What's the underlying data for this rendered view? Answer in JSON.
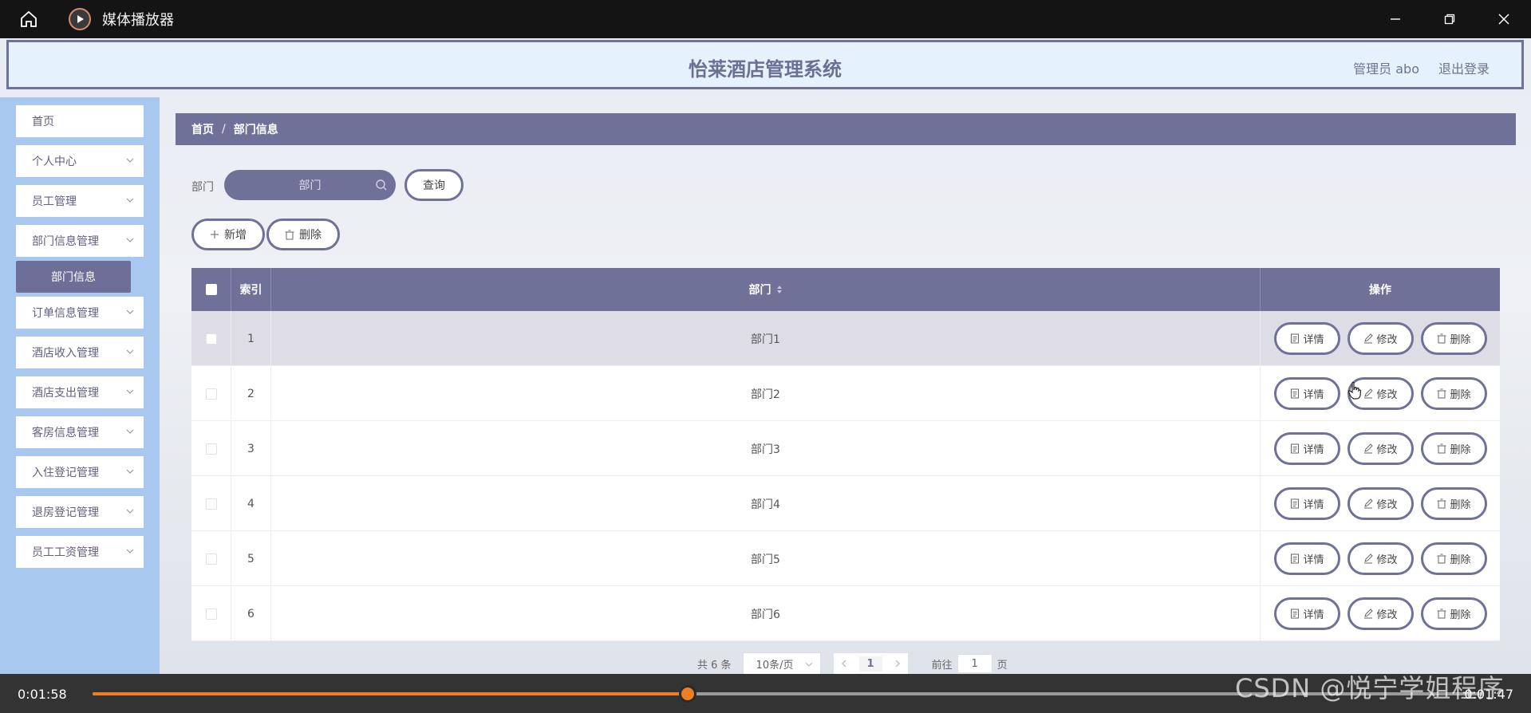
{
  "window": {
    "title": "媒体播放器"
  },
  "app": {
    "title": "怡莱酒店管理系统",
    "user": "管理员 abo",
    "logout": "退出登录"
  },
  "sidebar": {
    "items": [
      {
        "label": "首页",
        "has_chevron": false
      },
      {
        "label": "个人中心",
        "has_chevron": true
      },
      {
        "label": "员工管理",
        "has_chevron": true
      },
      {
        "label": "部门信息管理",
        "has_chevron": true
      },
      {
        "label": "订单信息管理",
        "has_chevron": true
      },
      {
        "label": "酒店收入管理",
        "has_chevron": true
      },
      {
        "label": "酒店支出管理",
        "has_chevron": true
      },
      {
        "label": "客房信息管理",
        "has_chevron": true
      },
      {
        "label": "入住登记管理",
        "has_chevron": true
      },
      {
        "label": "退房登记管理",
        "has_chevron": true
      },
      {
        "label": "员工工资管理",
        "has_chevron": true
      }
    ],
    "active_sub": "部门信息"
  },
  "breadcrumb": {
    "home": "首页",
    "sep": "/",
    "current": "部门信息"
  },
  "filter": {
    "label": "部门",
    "placeholder": "部门",
    "query_btn": "查询"
  },
  "toolbar": {
    "add_label": "新增",
    "delete_label": "删除"
  },
  "table": {
    "headers": {
      "index": "索引",
      "dept": "部门",
      "actions": "操作"
    },
    "rows": [
      {
        "index": "1",
        "dept": "部门1"
      },
      {
        "index": "2",
        "dept": "部门2"
      },
      {
        "index": "3",
        "dept": "部门3"
      },
      {
        "index": "4",
        "dept": "部门4"
      },
      {
        "index": "5",
        "dept": "部门5"
      },
      {
        "index": "6",
        "dept": "部门6"
      }
    ],
    "actions": {
      "detail": "详情",
      "edit": "修改",
      "delete": "删除"
    }
  },
  "pager": {
    "total": "共 6 条",
    "page_size": "10条/页",
    "current_page": "1",
    "goto_label": "前往",
    "goto_value": "1",
    "page_suffix": "页"
  },
  "player": {
    "elapsed": "0:01:58",
    "remaining": "0:01:47",
    "progress": 0.428
  },
  "watermark": "CSDN @悦宁学姐程序"
}
